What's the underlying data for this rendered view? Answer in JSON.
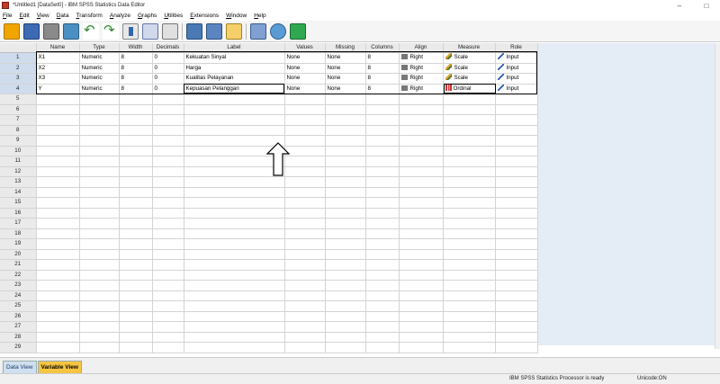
{
  "window": {
    "title": "*Untitled1 [DataSet0] - IBM SPSS Statistics Data Editor",
    "minimize": "–",
    "maximize": "□"
  },
  "menu": [
    "File",
    "Edit",
    "View",
    "Data",
    "Transform",
    "Analyze",
    "Graphs",
    "Utilities",
    "Extensions",
    "Window",
    "Help"
  ],
  "toolbar": {
    "icons": [
      "open-icon",
      "save-icon",
      "print-icon",
      "dialog-recall-icon",
      "undo-icon",
      "redo-icon",
      "goto-case-icon",
      "variables-icon",
      "find-icon",
      "insert-cases-icon",
      "split-file-icon",
      "weight-cases-icon",
      "value-labels-icon",
      "use-sets-icon",
      "run-script-icon"
    ]
  },
  "grid": {
    "columns": [
      "",
      "Name",
      "Type",
      "Width",
      "Decimals",
      "Label",
      "Values",
      "Missing",
      "Columns",
      "Align",
      "Measure",
      "Role"
    ],
    "rows": [
      {
        "num": "1",
        "name": "X1",
        "type": "Numeric",
        "width": "8",
        "decimals": "0",
        "label": "Kekuatan Sinyal",
        "values": "None",
        "missing": "None",
        "columns": "8",
        "align": "Right",
        "measure": "Scale",
        "measure_icon": "scale-icon",
        "role": "Input"
      },
      {
        "num": "2",
        "name": "X2",
        "type": "Numeric",
        "width": "8",
        "decimals": "0",
        "label": "Harga",
        "values": "None",
        "missing": "None",
        "columns": "8",
        "align": "Right",
        "measure": "Scale",
        "measure_icon": "scale-icon",
        "role": "Input"
      },
      {
        "num": "3",
        "name": "X3",
        "type": "Numeric",
        "width": "8",
        "decimals": "0",
        "label": "Kualitas Pelayanan",
        "values": "None",
        "missing": "None",
        "columns": "8",
        "align": "Right",
        "measure": "Scale",
        "measure_icon": "scale-icon",
        "role": "Input"
      },
      {
        "num": "4",
        "name": "Y",
        "type": "Numeric",
        "width": "8",
        "decimals": "0",
        "label": "Kepuasan Pelanggan",
        "values": "None",
        "missing": "None",
        "columns": "8",
        "align": "Right",
        "measure": "Ordinal",
        "measure_icon": "ordinal-icon",
        "role": "Input"
      }
    ],
    "empty_row_numbers": [
      "5",
      "6",
      "7",
      "8",
      "9",
      "10",
      "11",
      "12",
      "13",
      "14",
      "15",
      "16",
      "17",
      "18",
      "19",
      "20",
      "21",
      "22",
      "23",
      "24",
      "25",
      "26",
      "27",
      "28",
      "29"
    ]
  },
  "tabs": {
    "data_view": "Data View",
    "variable_view": "Variable View",
    "active": "Variable View"
  },
  "status": {
    "processor": "IBM SPSS Statistics Processor is ready",
    "encoding": "Unicode:ON"
  },
  "colors": {
    "active_tab": "#f5c542",
    "arrow": "#000000",
    "grid_side_bg": "#e4ecf5"
  }
}
